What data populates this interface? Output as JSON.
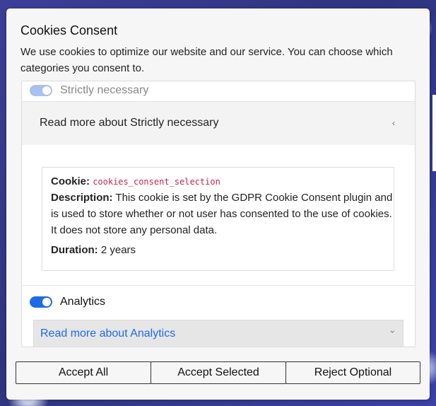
{
  "dialog": {
    "title": "Cookies Consent",
    "intro": "We use cookies to optimize our website and our service. You can choose which categories you consent to."
  },
  "categories": [
    {
      "name": "Strictly necessary",
      "enabled": true,
      "locked": true,
      "toggle_label": "Read more about Strictly necessary",
      "expanded": true,
      "cookie": {
        "cookie_label": "Cookie:",
        "cookie_value": "cookies_consent_selection",
        "description_label": "Description:",
        "description_line1": "This cookie is set by the GDPR Cookie Consent plugin and",
        "description_line2": "is used to store whether or not user has consented to the use of cookies.",
        "description_line3": "It does not store any personal data.",
        "duration_label": "Duration:",
        "duration_value": "2 years"
      }
    },
    {
      "name": "Analytics",
      "enabled": true,
      "locked": false,
      "toggle_label": "Read more about Analytics",
      "expanded": false
    }
  ],
  "buttons": {
    "accept_all": "Accept All",
    "accept_selected": "Accept Selected",
    "reject_optional": "Reject Optional"
  },
  "icons": {
    "collapse": "‹",
    "expand": "›"
  },
  "colors": {
    "accent": "#1e6be6",
    "code": "#c7254e",
    "backdrop": "#3b3f98"
  }
}
